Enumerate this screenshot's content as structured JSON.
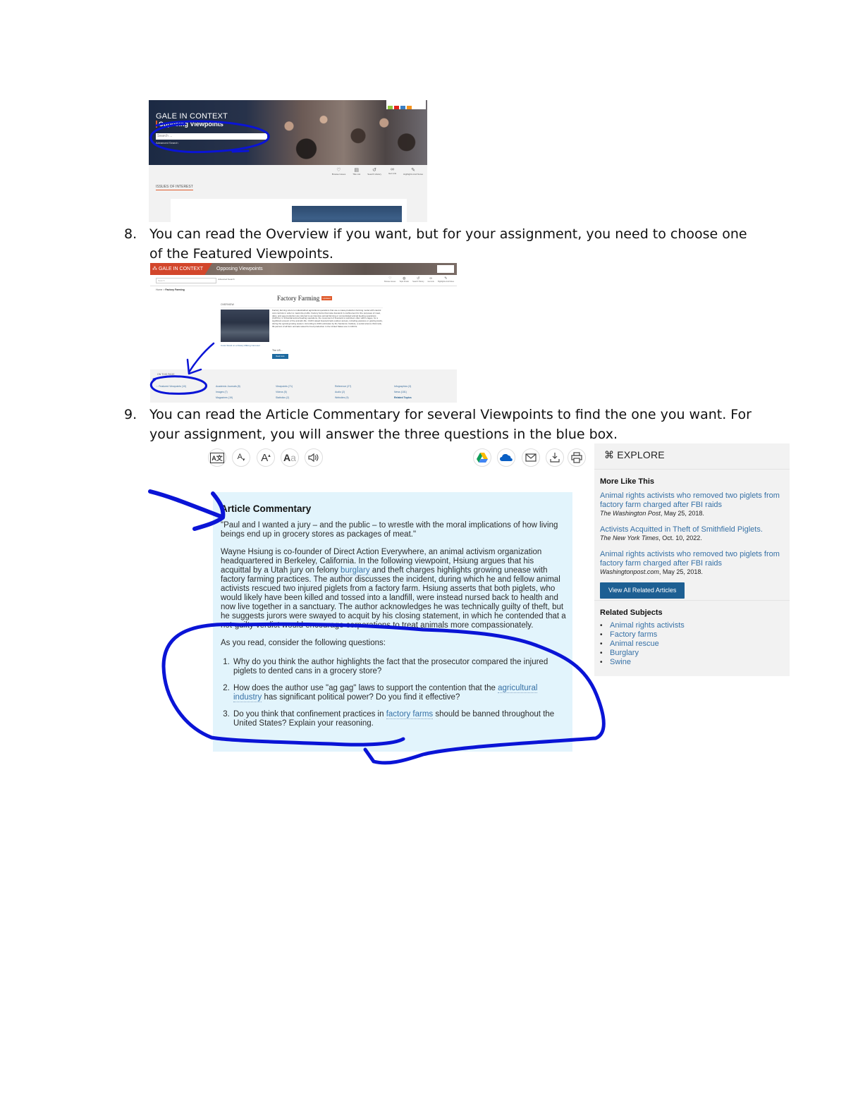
{
  "screenshot1": {
    "brand": "GALE IN CONTEXT",
    "product": "Opposing Viewpoints",
    "search_placeholder": "Search ...",
    "advanced_search": "Advanced Search",
    "tools": [
      {
        "icon": "lightbulb-icon",
        "label": "Browse Issues"
      },
      {
        "icon": "list-icon",
        "label": "Title List"
      },
      {
        "icon": "history-icon",
        "label": "Search History"
      },
      {
        "icon": "link-icon",
        "label": "Get Link"
      },
      {
        "icon": "pencil-icon",
        "label": "Highlights And Notes"
      }
    ],
    "section_label": "ISSUES OF INTEREST",
    "kvl_colors": [
      "#8cc63f",
      "#e2231a",
      "#3b7fc4",
      "#f7941d"
    ]
  },
  "step8": {
    "number": "8.",
    "text": "You can read the Overview if you want, but for your assignment, you need to choose one of the Featured Viewpoints."
  },
  "screenshot2": {
    "brand": "GALE IN CONTEXT",
    "product": "Opposing Viewpoints",
    "search_placeholder": "Search",
    "advanced_search": "Advanced Search",
    "tools": [
      {
        "icon": "lightbulb-icon",
        "label": "Browse Issues"
      },
      {
        "icon": "topic-finder-icon",
        "label": "Topic Finder"
      },
      {
        "icon": "history-icon",
        "label": "Search History"
      },
      {
        "icon": "link-icon",
        "label": "Get Link"
      },
      {
        "icon": "pencil-icon",
        "label": "Highlights And Notes"
      }
    ],
    "breadcrumb_home": "Home",
    "breadcrumb_sep": " > ",
    "breadcrumb_current": "Factory Farming",
    "page_title": "Factory Farming",
    "badge": "Updated",
    "overview_label": "OVERVIEW",
    "image_caption": "Cows Stand on a Rotary Milking Carousel",
    "overview_text": "Factory farming refers to industrialized agricultural operations that use a mass-production farming model with careful cost controls in order to maximize profits. Factory farms that raise livestock in confinement for the purposes of meat, dairy, and egg production are referred to as intensive animal farming or concentrated animal feeding operations (CAFOs). In industrial animal feeding operations, the movement of livestock is restricted, often within cages, for a significant amount of the animal's life. CAFO-raised livestock lack outdoor access, including pastures or grazing lands, during the typical growing season. According to 2019 estimates by the Sentience Institute, a social science think tank, 99 percent of all farm animals raised for food production in the United States are in CAFOs.",
    "overview_more": "The US...",
    "read_more": "Read more",
    "on_this_page_label": "ON THIS PAGE",
    "featured": "Featured Viewpoints (10)",
    "columns": [
      [
        "Academic Journals (8)",
        "Images (7)",
        "Magazines (19)"
      ],
      [
        "Viewpoints (71)",
        "Videos (5)",
        "Statistics (2)"
      ],
      [
        "Reference (27)",
        "Audio (2)",
        "Websites (9)"
      ],
      [
        "Infographics (3)",
        "News (181)",
        "Related Topics"
      ]
    ]
  },
  "step9": {
    "number": "9.",
    "text": "You can read the Article Commentary for several Viewpoints to find the one you want. For your assignment, you will answer the three questions in the blue box."
  },
  "toolbar": {
    "left": [
      {
        "icon": "translate-icon",
        "glyph": "A文",
        "label": "Translate"
      },
      {
        "icon": "font-decrease-icon",
        "glyph": "A▾",
        "label": "Decrease font size"
      },
      {
        "icon": "font-increase-icon",
        "glyph": "A▴",
        "label": "Increase font size"
      },
      {
        "icon": "display-options-icon",
        "glyph": "Aa",
        "label": "Display options"
      },
      {
        "icon": "listen-icon",
        "glyph": "🔊",
        "label": "Listen"
      }
    ],
    "right": [
      {
        "icon": "google-drive-icon",
        "label": "Send to Google Drive"
      },
      {
        "icon": "onedrive-icon",
        "label": "Send to OneDrive"
      },
      {
        "icon": "email-icon",
        "glyph": "✉",
        "label": "Email"
      },
      {
        "icon": "download-icon",
        "glyph": "⤓",
        "label": "Download"
      },
      {
        "icon": "print-icon",
        "glyph": "⎙",
        "label": "Print"
      }
    ]
  },
  "commentary": {
    "heading": "Article Commentary",
    "quote": "\"Paul and I wanted a jury – and the public – to wrestle with the moral implications of how living beings end up in grocery stores as packages of meat.\"",
    "summary_before_link": "Wayne Hsiung is co-founder of Direct Action Everywhere, an animal activism organization headquartered in Berkeley, California. In the following viewpoint, Hsiung argues that his acquittal by a Utah jury on felony ",
    "summary_link": "burglary",
    "summary_after_link": " and theft charges highlights growing unease with factory farming practices. The author discusses the incident, during which he and fellow animal activists rescued two injured piglets from a factory farm. Hsiung asserts that both piglets, who would likely have been killed and tossed into a landfill, were instead nursed back to health and now live together in a sanctuary. The author acknowledges he was technically guilty of theft, but he suggests jurors were swayed to acquit by his closing statement, in which he contended that a not-guilty verdict would encourage corporations to treat animals more compassionately.",
    "questions_intro": "As you read, consider the following questions:",
    "questions": [
      {
        "before": "Why do you think the author highlights the fact that the prosecutor compared the injured piglets to dented cans in a grocery store?",
        "link": "",
        "after": ""
      },
      {
        "before": "How does the author use \"ag gag\" laws to support the contention that the ",
        "link": "agricultural industry",
        "after": " has significant political power? Do you find it effective?"
      },
      {
        "before": "Do you think that confinement practices in ",
        "link": "factory farms",
        "after": " should be banned throughout the United States? Explain your reasoning."
      }
    ]
  },
  "explore": {
    "heading": "EXPLORE",
    "more_like_this": "More Like This",
    "articles": [
      {
        "title": "Animal rights activists who removed two piglets from factory farm charged after FBI raids",
        "source": "The Washington Post",
        "date": ", May 25, 2018."
      },
      {
        "title": "Activists Acquitted in Theft of Smithfield Piglets.",
        "source": "The New York Times",
        "date": ", Oct. 10, 2022."
      },
      {
        "title": "Animal rights activists who removed two piglets from factory farm charged after FBI raids",
        "source": "Washingtonpost.com",
        "date": ", May 25, 2018."
      }
    ],
    "view_all": "View All Related Articles",
    "related_subjects": "Related Subjects",
    "subjects": [
      "Animal rights activists",
      "Factory farms",
      "Animal rescue",
      "Burglary",
      "Swine"
    ]
  },
  "colors": {
    "annotation_ink": "#0a14d6",
    "commentary_bg": "#e2f4fc",
    "link": "#3771a6",
    "gale_orange": "#d2462b",
    "button_blue": "#1d5f93"
  }
}
